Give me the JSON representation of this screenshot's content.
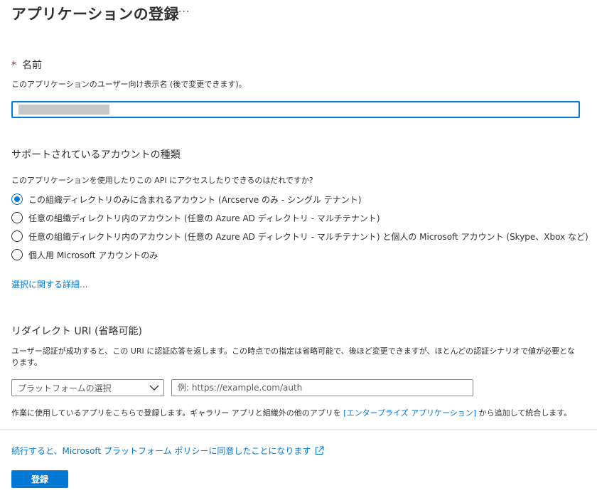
{
  "page": {
    "title": "アプリケーションの登録",
    "more_label": "···"
  },
  "name_section": {
    "required_mark": "*",
    "label": "名前",
    "description": "このアプリケーションのユーザー向け表示名 (後で変更できます)。",
    "value": ""
  },
  "account_section": {
    "heading": "サポートされているアカウントの種類",
    "question": "このアプリケーションを使用したりこの API にアクセスしたりできるのはだれですか?",
    "options": [
      {
        "label": "この組織ディレクトリのみに含まれるアカウント (Arcserve のみ - シングル テナント)",
        "checked": true
      },
      {
        "label": "任意の組織ディレクトリ内のアカウント (任意の Azure AD ディレクトリ - マルチテナント)",
        "checked": false
      },
      {
        "label": "任意の組織ディレクトリ内のアカウント (任意の Azure AD ディレクトリ - マルチテナント) と個人の Microsoft アカウント (Skype、Xbox など)",
        "checked": false
      },
      {
        "label": "個人用 Microsoft アカウントのみ",
        "checked": false
      }
    ],
    "details_link": "選択に関する詳細..."
  },
  "redirect_section": {
    "heading": "リダイレクト URI (省略可能)",
    "description_line1": "ユーザー認証が成功すると、この URI に認証応答を返します。この時点での指定は省略可能で、後ほど変更できますが、ほとんどの認証シナリオで値が必要とな",
    "description_line2": "ります。",
    "platform_placeholder": "プラットフォームの選択",
    "uri_placeholder": "例: https://example.com/auth",
    "note_before": "作業に使用しているアプリをこちらで登録します。ギャラリー アプリと組織外の他のアプリを ",
    "note_link": "[エンタープライズ アプリケーション]",
    "note_after": " から追加して統合します。"
  },
  "footer": {
    "policy_link": "続行すると、Microsoft プラットフォーム ポリシーに同意したことになります",
    "register_label": "登録"
  },
  "colors": {
    "accent": "#0078d4",
    "required": "#a4262c",
    "text": "#323130"
  }
}
